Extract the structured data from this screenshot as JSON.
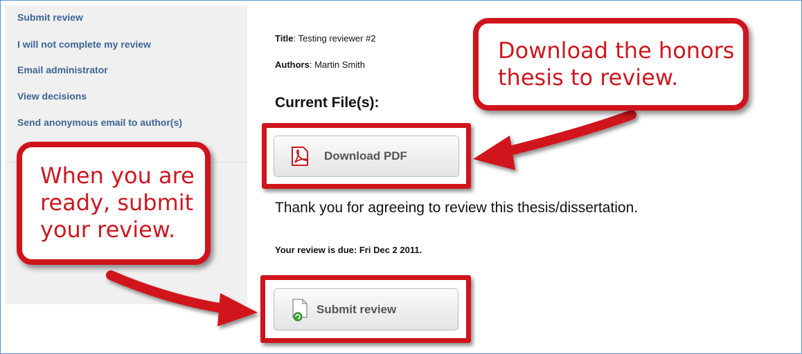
{
  "sidebar": {
    "items": [
      {
        "label": "Submit review"
      },
      {
        "label": "I will not complete my review"
      },
      {
        "label": "Email administrator"
      },
      {
        "label": "View decisions"
      },
      {
        "label": "Send anonymous email to author(s)"
      }
    ]
  },
  "article": {
    "title_label": "Title",
    "title_value": ": Testing reviewer #2",
    "authors_label": "Authors",
    "authors_value": ": Martin Smith",
    "files_heading": "Current File(s):",
    "download_label": "Download PDF",
    "thanks_text": "Thank you for agreeing to review this thesis/dissertation.",
    "due_text": "Your review is due: Fri Dec 2 2011.",
    "submit_label": "Submit review"
  },
  "callouts": {
    "download": {
      "line1": "Download the honors",
      "line2": "thesis to review."
    },
    "submit": {
      "line1": "When you are",
      "line2": "ready, submit",
      "line3": "your review."
    }
  },
  "colors": {
    "annotation_red": "#d0141c",
    "link_blue": "#3c6494",
    "sidebar_bg": "#f0f0f0"
  }
}
